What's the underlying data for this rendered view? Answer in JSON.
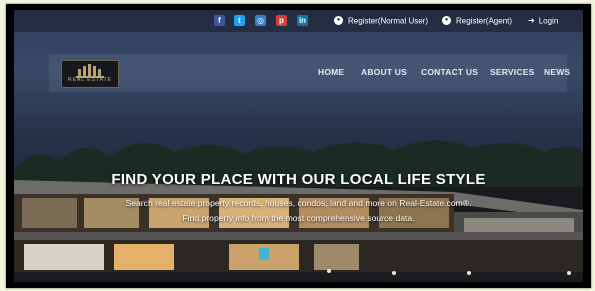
{
  "social": [
    {
      "icon": "facebook-icon",
      "glyph": "f",
      "color": "#3b5998"
    },
    {
      "icon": "twitter-icon",
      "glyph": "t",
      "color": "#1da1f2"
    },
    {
      "icon": "instagram-icon",
      "glyph": "◎",
      "color": "#3a7ec8"
    },
    {
      "icon": "pinterest-icon",
      "glyph": "p",
      "color": "#d63a3a"
    },
    {
      "icon": "linkedin-icon",
      "glyph": "in",
      "color": "#0e76a8"
    }
  ],
  "topbar": {
    "register_user": "Register(Normal User)",
    "register_agent": "Register(Agent)",
    "login": "Login"
  },
  "logo": {
    "text": "REAL ESTATE"
  },
  "nav": {
    "home": "HOME",
    "about": "ABOUT US",
    "contact": "CONTACT US",
    "services": "SERVICES",
    "news": "NEWS"
  },
  "hero": {
    "title": "FIND YOUR PLACE WITH OUR LOCAL LIFE STYLE",
    "line1": "Search real estate property records, houses, condos, land and more on Real-Estate.com®.",
    "line2": "Find property info from the most comprehensive source data."
  }
}
